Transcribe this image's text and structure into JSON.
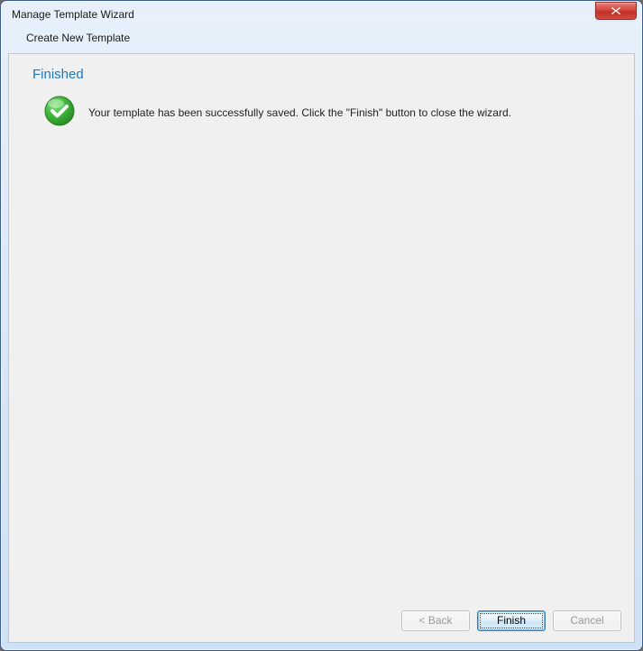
{
  "window": {
    "title": "Manage Template Wizard",
    "subtitle": "Create New Template"
  },
  "page": {
    "heading": "Finished",
    "message": "Your template has been successfully saved. Click the \"Finish\" button to close the wizard."
  },
  "buttons": {
    "back": "< Back",
    "finish": "Finish",
    "cancel": "Cancel"
  }
}
